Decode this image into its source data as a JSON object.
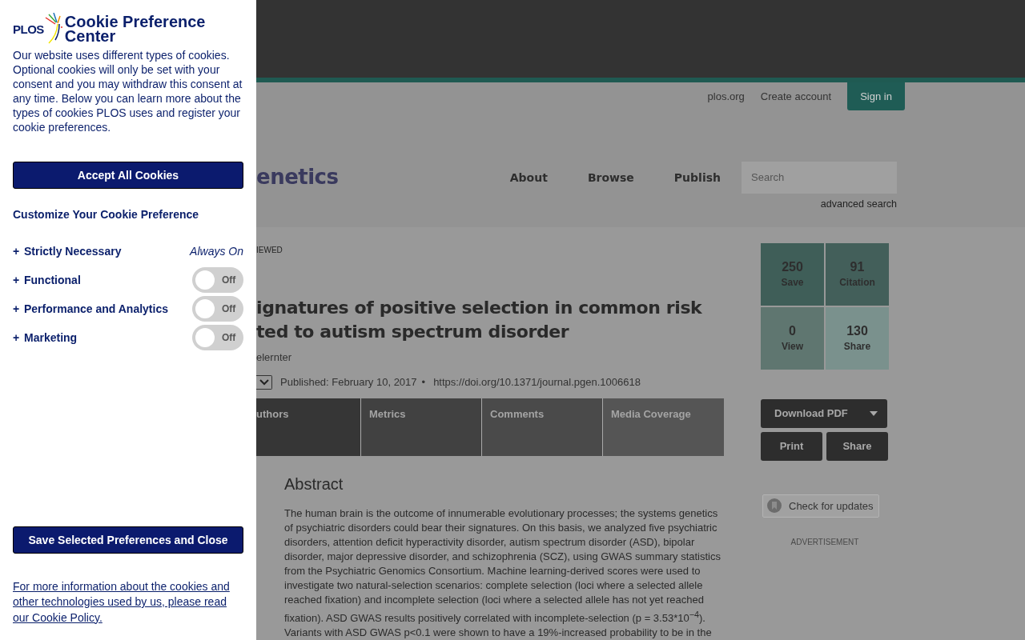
{
  "cookie_panel": {
    "logo_text": "PLOS",
    "title": "Cookie Preference Center",
    "description": "Our website uses different types of cookies. Optional cookies will only be set with your consent and you may withdraw this consent at any time. Below you can learn more about the types of cookies PLOS uses and register your cookie preferences.",
    "accept_button": "Accept All Cookies",
    "customize_heading": "Customize Your Cookie Preference",
    "categories": [
      {
        "expander": "+",
        "label": "Strictly Necessary",
        "kind": "always",
        "status": "Always On"
      },
      {
        "expander": "+",
        "label": "Functional",
        "kind": "toggle",
        "on": false,
        "status": "Off"
      },
      {
        "expander": "+",
        "label": "Performance and Analytics",
        "kind": "toggle",
        "on": false,
        "status": "Off"
      },
      {
        "expander": "+",
        "label": "Marketing",
        "kind": "toggle",
        "on": false,
        "status": "Off"
      }
    ],
    "save_button": "Save Selected Preferences and Close",
    "policy_link": "For more information about the cookies and other technologies used by us, please read our Cookie Policy."
  },
  "page": {
    "top_links": [
      "plos.org",
      "Create account"
    ],
    "sign_in": "Sign in",
    "journal_logo": "enetics",
    "nav": [
      "About",
      "Browse",
      "Publish"
    ],
    "search": {
      "placeholder": "Search"
    },
    "advanced_search": "advanced search",
    "article": {
      "badge": "IEWED",
      "title_lines": [
        "ignatures of positive selection in common risk",
        "ted to autism spectrum disorder"
      ],
      "authors": "elernter",
      "published": "Published: February 10, 2017",
      "separator": "•",
      "doi": "https://doi.org/10.1371/journal.pgen.1006618",
      "tabs": [
        "uthors",
        "Metrics",
        "Comments",
        "Media Coverage"
      ],
      "abstract_heading": "Abstract",
      "abstract": "The human brain is the outcome of innumerable evolutionary processes; the systems genetics of psychiatric disorders could bear their signatures. On this basis, we analyzed five psychiatric disorders, attention deficit hyperactivity disorder, autism spectrum disorder (ASD), bipolar disorder, major depressive disorder, and schizophrenia (SCZ), using GWAS summary statistics from the Psychiatric Genomics Consortium. Machine learning-derived scores were used to investigate two natural-selection scenarios: complete selection (loci where a selected allele reached fixation) and incomplete selection (loci where a selected allele has not yet reached fixation). ASD GWAS results positively correlated with incomplete-selection (p = 3.53*10$^{−4}$). Variants with ASD GWAS p<0.1 were shown to have a 19%-increased probability to be in the"
    },
    "metrics": [
      {
        "value": "250",
        "label": "Save"
      },
      {
        "value": "91",
        "label": "Citation"
      },
      {
        "value": "0",
        "label": "View"
      },
      {
        "value": "130",
        "label": "Share"
      }
    ],
    "download_button": "Download PDF",
    "print_button": "Print",
    "share_button": "Share",
    "check_updates": "Check for updates",
    "advertisement": "ADVERTISEMENT"
  }
}
